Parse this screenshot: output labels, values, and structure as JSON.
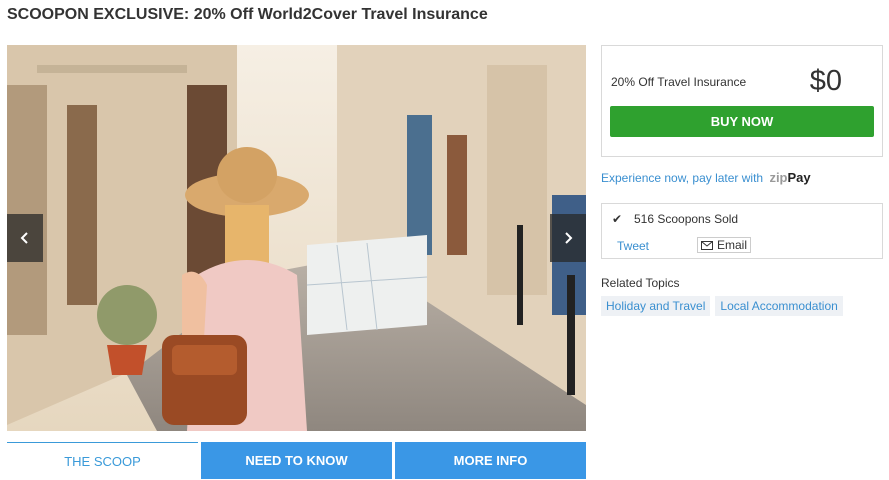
{
  "page": {
    "title": "SCOOPON EXCLUSIVE: 20% Off World2Cover Travel Insurance"
  },
  "carousel": {
    "prev_icon": "chevron-left-icon",
    "next_icon": "chevron-right-icon"
  },
  "tabs": [
    {
      "label": "THE SCOOP"
    },
    {
      "label": "NEED TO KNOW"
    },
    {
      "label": "MORE INFO"
    }
  ],
  "deal": {
    "label": "20% Off Travel Insurance",
    "price": "$0",
    "buy_label": "BUY NOW"
  },
  "zippay": {
    "text": "Experience now, pay later with",
    "logo_zip": "zip",
    "logo_pay": "Pay"
  },
  "social": {
    "sold_text": "516 Scoopons Sold",
    "tweet_label": "Tweet",
    "email_label": "Email"
  },
  "related": {
    "title": "Related Topics",
    "topics": [
      "Holiday and Travel",
      "Local Accommodation"
    ]
  },
  "colors": {
    "buy_green": "#2fa12f",
    "tab_blue": "#3a97e6",
    "link_blue": "#3a8fd0"
  }
}
